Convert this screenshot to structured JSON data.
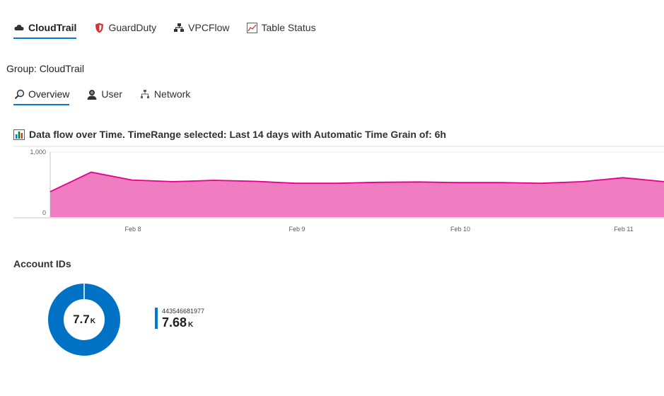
{
  "top_tabs": [
    {
      "label": "CloudTrail",
      "icon": "cloud-icon",
      "active": true
    },
    {
      "label": "GuardDuty",
      "icon": "shield-icon",
      "active": false
    },
    {
      "label": "VPCFlow",
      "icon": "network-flow-icon",
      "active": false
    },
    {
      "label": "Table Status",
      "icon": "line-chart-icon",
      "active": false
    }
  ],
  "group_title": "Group: CloudTrail",
  "sub_tabs": [
    {
      "label": "Overview",
      "icon": "magnifier-icon",
      "active": true
    },
    {
      "label": "User",
      "icon": "user-icon",
      "active": false
    },
    {
      "label": "Network",
      "icon": "network-icon",
      "active": false
    }
  ],
  "chart": {
    "title": "Data flow over Time. TimeRange selected: Last 14 days with Automatic Time Grain of: 6h",
    "icon": "bar-chart-icon"
  },
  "chart_data": {
    "type": "area",
    "y_ticks": [
      "1,000",
      "0"
    ],
    "ylim": [
      0,
      1000
    ],
    "x_tick_labels": [
      "Feb 8",
      "Feb 9",
      "Feb 10",
      "Feb 11"
    ],
    "values": [
      390,
      690,
      570,
      545,
      565,
      550,
      520,
      520,
      535,
      540,
      530,
      530,
      520,
      545,
      605,
      545
    ],
    "color": "#f07dc1",
    "line_color": "#e3008c",
    "grid": true
  },
  "accounts": {
    "title": "Account IDs",
    "donut_total": "7.7",
    "donut_unit": "K",
    "legend_id": "443546681977",
    "legend_value": "7.68",
    "legend_unit": "K",
    "color": "#0072c6",
    "share": 0.99
  }
}
